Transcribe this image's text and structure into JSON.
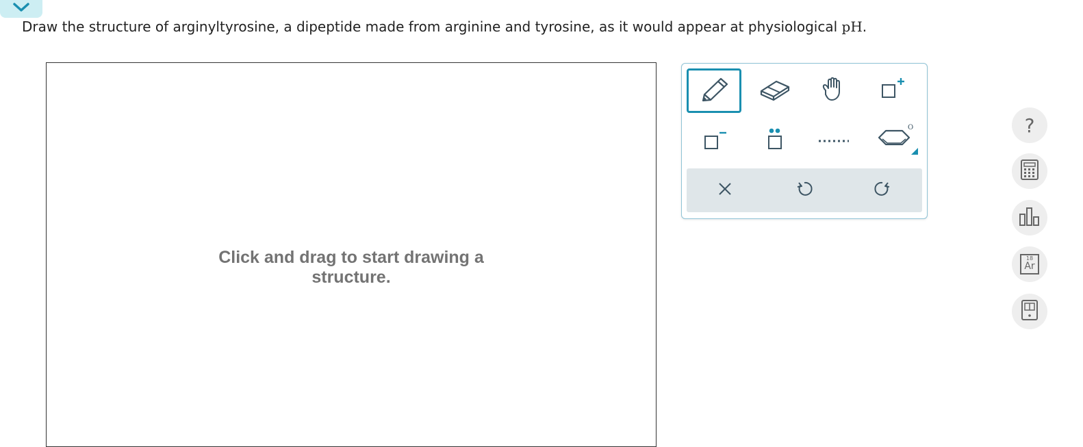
{
  "header": {
    "collapse_icon": "chevron-down-icon",
    "accent_color": "#1a8fb0",
    "tab_color": "#cdeef3"
  },
  "question": {
    "text": "Draw the structure of arginyltyrosine, a dipeptide made from arginine and tyrosine, as it would appear at physiological",
    "ph_label": "pH",
    "end_punct": "."
  },
  "canvas": {
    "hint": "Click and drag to start drawing a structure."
  },
  "toolbox": {
    "tools": [
      {
        "name": "pencil-icon",
        "selected": true
      },
      {
        "name": "eraser-icon",
        "selected": false
      },
      {
        "name": "hand-icon",
        "selected": false
      },
      {
        "name": "positive-charge-icon",
        "selected": false,
        "sign": "+"
      },
      {
        "name": "negative-charge-icon",
        "selected": false,
        "sign": "−"
      },
      {
        "name": "lone-pair-icon",
        "selected": false
      },
      {
        "name": "dotted-bond-icon",
        "selected": false
      },
      {
        "name": "ring-template-icon",
        "selected": false
      }
    ],
    "actions": [
      {
        "name": "clear-icon"
      },
      {
        "name": "undo-icon"
      },
      {
        "name": "redo-icon"
      }
    ]
  },
  "sidebar": {
    "help": "?",
    "periodic_number": "18",
    "periodic_symbol": "Ar",
    "buttons": [
      "help-icon",
      "calculator-icon",
      "chart-icon",
      "periodic-table-icon",
      "reference-book-icon"
    ]
  }
}
